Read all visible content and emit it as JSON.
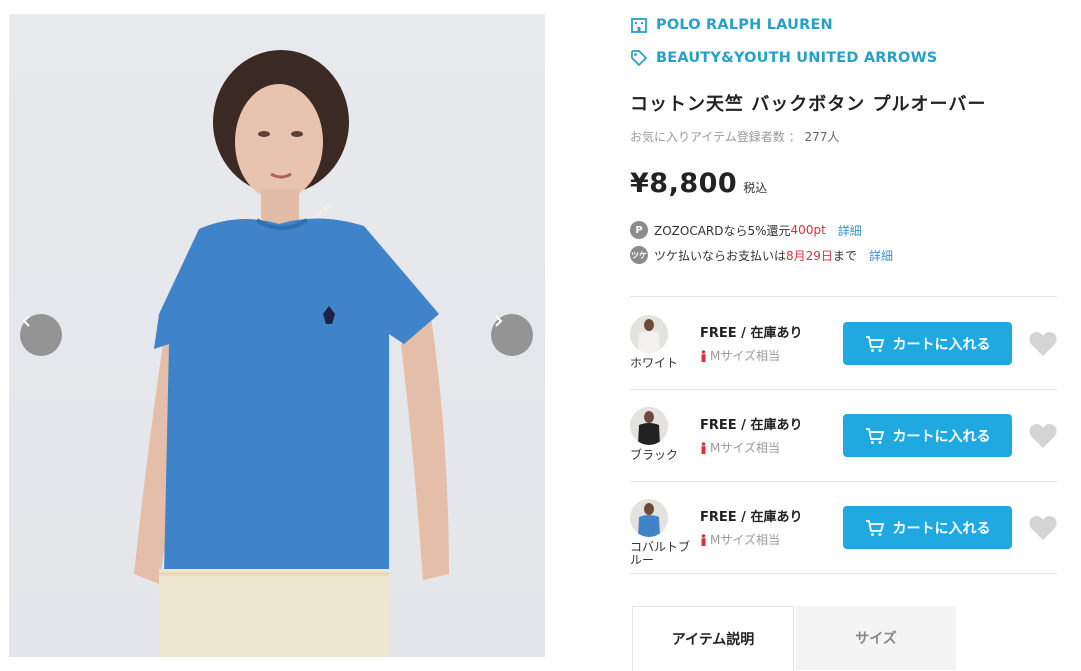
{
  "gallery": {
    "prev_icon": "chevron-left-icon",
    "next_icon": "chevron-right-icon"
  },
  "brand": {
    "name": "POLO RALPH LAUREN",
    "icon": "building-icon"
  },
  "shop": {
    "name": "BEAUTY&YOUTH UNITED ARROWS",
    "icon": "tag-icon"
  },
  "product": {
    "title": "コットン天竺 バックボタン プルオーバー",
    "fav_label": "お気に入りアイテム登録者数",
    "fav_sep": "：",
    "fav_count": "277人",
    "price": "¥8,800",
    "tax": "税込"
  },
  "promo1": {
    "badge": "P",
    "pre": "ZOZOCARDなら",
    "rate": "5%還元",
    "points": "400pt",
    "link": "詳細"
  },
  "promo2": {
    "badge": "ツケ",
    "pre": "ツケ払いならお支払いは",
    "date": "8月29日",
    "post": "まで",
    "link": "詳細"
  },
  "skus": [
    {
      "color": "ホワイト",
      "size": "FREE / 在庫あり",
      "fit": "Mサイズ相当",
      "button": "カートに入れる"
    },
    {
      "color": "ブラック",
      "size": "FREE / 在庫あり",
      "fit": "Mサイズ相当",
      "button": "カートに入れる"
    },
    {
      "color": "コバルトブルー",
      "size": "FREE / 在庫あり",
      "fit": "Mサイズ相当",
      "button": "カートに入れる"
    }
  ],
  "tabs": [
    {
      "label": "アイテム説明"
    },
    {
      "label": "サイズ"
    }
  ],
  "colors": {
    "accent": "#27a0c8",
    "cart": "#20a9e1",
    "sale_red": "#d8323c",
    "link": "#3a8fc7"
  }
}
